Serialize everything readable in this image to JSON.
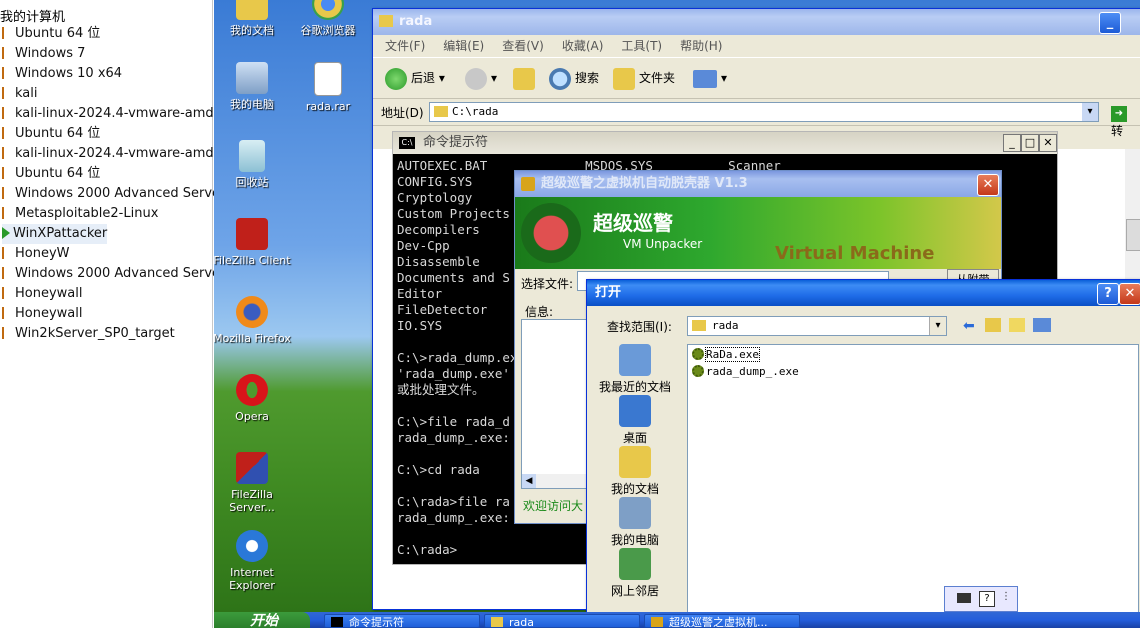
{
  "vm_library": {
    "title": "我的计算机",
    "items": [
      {
        "label": "Ubuntu 64 位",
        "selected": false
      },
      {
        "label": "Windows 7",
        "selected": false
      },
      {
        "label": "Windows 10 x64",
        "selected": false
      },
      {
        "label": "kali",
        "selected": false
      },
      {
        "label": "kali-linux-2024.4-vmware-amd64",
        "selected": false
      },
      {
        "label": "Ubuntu 64 位",
        "selected": false
      },
      {
        "label": "kali-linux-2024.4-vmware-amd64",
        "selected": false
      },
      {
        "label": "Ubuntu 64 位",
        "selected": false
      },
      {
        "label": "Windows 2000 Advanced Server",
        "selected": false
      },
      {
        "label": "Metasploitable2-Linux",
        "selected": false
      },
      {
        "label": "WinXPattacker",
        "selected": true
      },
      {
        "label": "HoneyW",
        "selected": false
      },
      {
        "label": "Windows 2000 Advanced Server",
        "selected": false
      },
      {
        "label": "Honeywall",
        "selected": false
      },
      {
        "label": "Honeywall",
        "selected": false
      },
      {
        "label": "Win2kServer_SP0_target",
        "selected": false
      }
    ]
  },
  "desktop_icons": {
    "my_documents": "我的文档",
    "chrome": "谷歌浏览器",
    "my_computer": "我的电脑",
    "rada_rar": "rada.rar",
    "recycle_bin": "回收站",
    "filezilla_client": "FileZilla Client",
    "firefox": "Mozilla Firefox",
    "opera": "Opera",
    "filezilla_server": "FileZilla Server...",
    "ie": "Internet Explorer"
  },
  "explorer": {
    "title": "rada",
    "menu": [
      "文件(F)",
      "编辑(E)",
      "查看(V)",
      "收藏(A)",
      "工具(T)",
      "帮助(H)"
    ],
    "toolbar": {
      "back": "后退",
      "search": "搜索",
      "folders": "文件夹"
    },
    "address_label": "地址(D)",
    "address_value": "C:\\rada",
    "go_label": "转"
  },
  "cmd": {
    "title": "命令提示符",
    "lines": [
      "AUTOEXEC.BAT             MSDOS.SYS          Scanner",
      "CONFIG.SYS",
      "Cryptology",
      "Custom Projects",
      "Decompilers",
      "Dev-Cpp",
      "Disassemble",
      "Documents and S",
      "Editor",
      "FileDetector",
      "IO.SYS",
      "",
      "C:\\>rada_dump.ex",
      "'rada_dump.exe'",
      "或批处理文件。",
      "",
      "C:\\>file rada_d",
      "rada_dump_.exe:",
      "",
      "C:\\>cd rada",
      "",
      "C:\\rada>file ra",
      "rada_dump_.exe:",
      "",
      "C:\\rada>"
    ]
  },
  "unpacker": {
    "title": "超级巡警之虚拟机自动脱壳器 V1.3",
    "banner_title": "超级巡警",
    "banner_subtitle": "VM Unpacker",
    "banner_brand": "Virtual Machine",
    "select_file_label": "选择文件:",
    "info_label": "信息:",
    "welcome_text": "欢迎访问大",
    "unpack_button": "从附带"
  },
  "open_dialog": {
    "title": "打开",
    "lookin_label": "查找范围(I):",
    "lookin_value": "rada",
    "places": [
      "我最近的文档",
      "桌面",
      "我的文档",
      "我的电脑",
      "网上邻居"
    ],
    "files": [
      "RaDa.exe",
      "rada_dump_.exe"
    ]
  },
  "taskbar": {
    "start": "开始",
    "tasks": [
      "命令提示符",
      "rada",
      "超级巡警之虚拟机..."
    ]
  },
  "colors": {
    "xp_blue": "#0a5fd8",
    "desktop_grass": "#3f8a22",
    "taskbar": "#245ddb",
    "start_green": "#3c9b3c"
  }
}
